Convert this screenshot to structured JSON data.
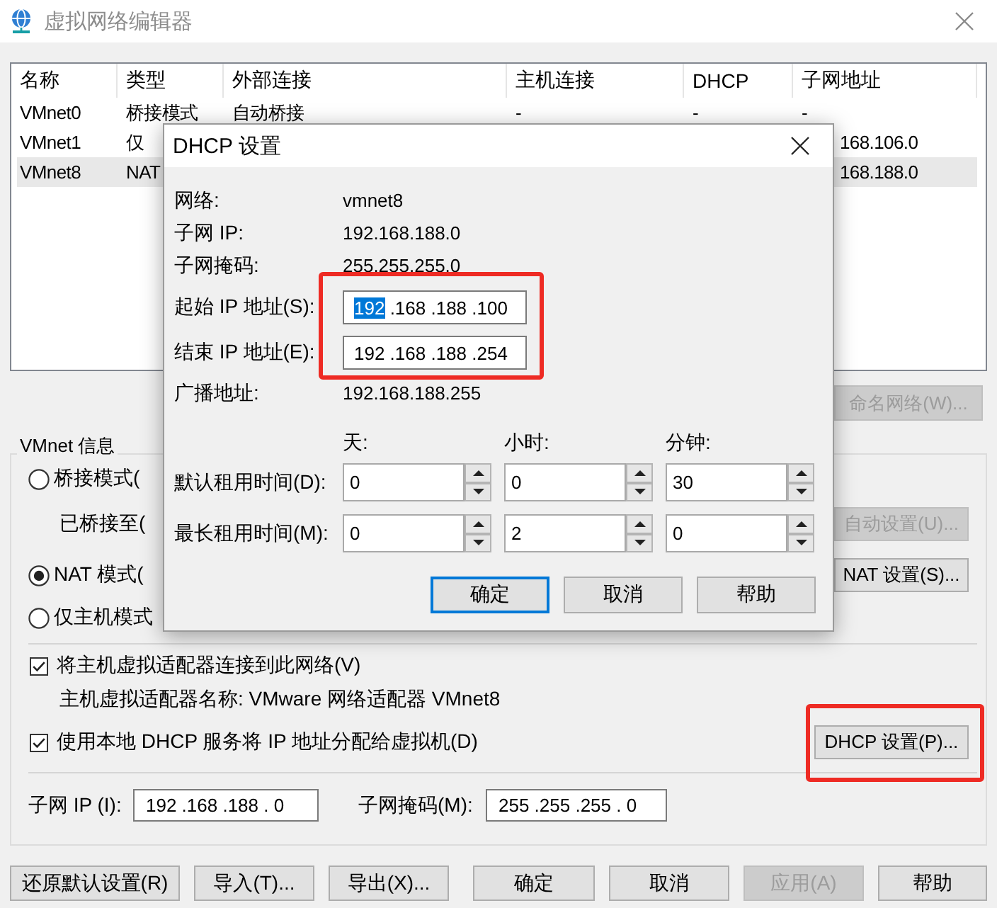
{
  "window": {
    "title": "虚拟网络编辑器"
  },
  "network_table": {
    "columns": [
      "名称",
      "类型",
      "外部连接",
      "主机连接",
      "DHCP",
      "子网地址"
    ],
    "rows": [
      {
        "name": "VMnet0",
        "type": "桥接模式",
        "external": "自动桥接",
        "host": "-",
        "dhcp": "-",
        "subnet": "-",
        "selected": false
      },
      {
        "name": "VMnet1",
        "type": "仅",
        "subnet": "168.106.0",
        "selected": false
      },
      {
        "name": "VMnet8",
        "type": "NAT",
        "subnet": "168.188.0",
        "selected": true
      }
    ]
  },
  "rename_button": {
    "label": "命名网络(W)...",
    "disabled": true
  },
  "vmnet_info": {
    "title": "VMnet 信息",
    "modes": [
      {
        "kind": "radio",
        "label": "桥接模式(",
        "selected": false
      },
      {
        "kind": "text",
        "label": "已桥接至(",
        "button": {
          "label": "自动设置(U)...",
          "disabled": true
        }
      },
      {
        "kind": "radio",
        "label": "NAT 模式(",
        "selected": true,
        "button": {
          "label": "NAT 设置(S)...",
          "disabled": false
        }
      },
      {
        "kind": "radio",
        "label": "仅主机模式",
        "selected": false
      }
    ],
    "options": [
      {
        "kind": "checkbox",
        "label": "将主机虚拟适配器连接到此网络(V)",
        "checked": true
      },
      {
        "kind": "text",
        "label": "主机虚拟适配器名称: VMware 网络适配器 VMnet8"
      },
      {
        "kind": "checkbox",
        "label": "使用本地 DHCP 服务将 IP 地址分配给虚拟机(D)",
        "checked": true,
        "button": {
          "label": "DHCP 设置(P)...",
          "disabled": false,
          "highlighted": true
        }
      }
    ],
    "subnet_ip": {
      "label": "子网 IP (I):",
      "value": "192 .168 .188 . 0"
    },
    "subnet_mask": {
      "label": "子网掩码(M):",
      "value": "255 .255 .255 . 0"
    }
  },
  "footer": {
    "left_buttons": [
      {
        "label": "还原默认设置(R)",
        "disabled": false
      },
      {
        "label": "导入(T)...",
        "disabled": false
      },
      {
        "label": "导出(X)...",
        "disabled": false
      }
    ],
    "right_buttons": [
      {
        "label": "确定",
        "disabled": false
      },
      {
        "label": "取消",
        "disabled": false
      },
      {
        "label": "应用(A)",
        "disabled": true
      },
      {
        "label": "帮助",
        "disabled": false
      }
    ]
  },
  "dhcp_dialog": {
    "title": "DHCP 设置",
    "info": [
      {
        "label": "网络:",
        "value": "vmnet8"
      },
      {
        "label": "子网 IP:",
        "value": "192.168.188.0"
      },
      {
        "label": "子网掩码:",
        "value": "255.255.255.0"
      }
    ],
    "ip_range": {
      "highlighted": true,
      "fields": [
        {
          "label": "起始 IP 地址(S):",
          "parts": [
            {
              "text": "192",
              "selected": true
            },
            {
              "text": " .168 .188 .100",
              "selected": false
            }
          ]
        },
        {
          "label": "结束 IP 地址(E):",
          "parts": [
            {
              "text": "192 .168 .188 .254",
              "selected": false
            }
          ]
        }
      ]
    },
    "broadcast": {
      "label": "广播地址:",
      "value": "192.168.188.255"
    },
    "lease_units": [
      "天:",
      "小时:",
      "分钟:"
    ],
    "leases": [
      {
        "label": "默认租用时间(D):",
        "values": [
          "0",
          "0",
          "30"
        ]
      },
      {
        "label": "最长租用时间(M):",
        "values": [
          "0",
          "2",
          "0"
        ]
      }
    ],
    "buttons": [
      {
        "label": "确定",
        "focused": true
      },
      {
        "label": "取消",
        "focused": false
      },
      {
        "label": "帮助",
        "focused": false
      }
    ]
  }
}
